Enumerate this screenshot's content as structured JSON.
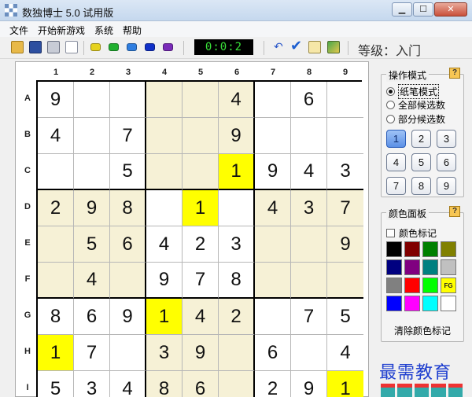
{
  "window": {
    "title": "数独博士 5.0 试用版"
  },
  "menu": [
    "文件",
    "开始新游戏",
    "系统",
    "帮助"
  ],
  "toolbar": {
    "timer": "0:0:2",
    "level": "等级：入门",
    "color_buttons": [
      "#e6d21f",
      "#20b030",
      "#2f7ee0",
      "#1030c8",
      "#7a2bb8"
    ]
  },
  "board": {
    "col_labels": [
      "1",
      "2",
      "3",
      "4",
      "5",
      "6",
      "7",
      "8",
      "9"
    ],
    "row_labels": [
      "A",
      "B",
      "C",
      "D",
      "E",
      "F",
      "G",
      "H",
      "I"
    ],
    "values": [
      [
        "9",
        "",
        "",
        "",
        "",
        "4",
        "",
        "6",
        ""
      ],
      [
        "4",
        "",
        "7",
        "",
        "",
        "9",
        "",
        "",
        ""
      ],
      [
        "",
        "",
        "5",
        "",
        "",
        "1",
        "9",
        "4",
        "3"
      ],
      [
        "2",
        "9",
        "8",
        "",
        "1",
        "",
        "4",
        "3",
        "7"
      ],
      [
        "",
        "5",
        "6",
        "4",
        "2",
        "3",
        "",
        "",
        "9"
      ],
      [
        "",
        "4",
        "",
        "9",
        "7",
        "8",
        "",
        "",
        ""
      ],
      [
        "8",
        "6",
        "9",
        "1",
        "4",
        "2",
        "",
        "7",
        "5"
      ],
      [
        "1",
        "7",
        "",
        "3",
        "9",
        "",
        "6",
        "",
        "4"
      ],
      [
        "5",
        "3",
        "4",
        "8",
        "6",
        "",
        "2",
        "9",
        "1"
      ]
    ],
    "highlight_cells": [
      "C6",
      "D5",
      "G4",
      "H1",
      "I9"
    ],
    "colors": {
      "box_shade": "#f6f1d6",
      "highlight": "#ffff00",
      "plain": "#ffffff"
    }
  },
  "mode_panel": {
    "title": "操作模式",
    "help": "?",
    "options": [
      {
        "label": "纸笔模式",
        "selected": true
      },
      {
        "label": "全部候选数",
        "selected": false
      },
      {
        "label": "部分候选数",
        "selected": false
      }
    ],
    "numbers": [
      "1",
      "2",
      "3",
      "4",
      "5",
      "6",
      "7",
      "8",
      "9"
    ],
    "active_number": "1"
  },
  "color_panel": {
    "title": "颜色面板",
    "help": "?",
    "checkbox_label": "颜色标记",
    "swatches": [
      "#000000",
      "#800000",
      "#008000",
      "#808000",
      "#000080",
      "#800080",
      "#008080",
      "#c0c0c0",
      "#808080",
      "#ff0000",
      "#00ff00",
      "#ffff00",
      "#0000ff",
      "#ff00ff",
      "#00ffff",
      "#ffffff"
    ],
    "fg_label": "FG",
    "clear_label": "清除颜色标记"
  },
  "watermark": "最需教育"
}
